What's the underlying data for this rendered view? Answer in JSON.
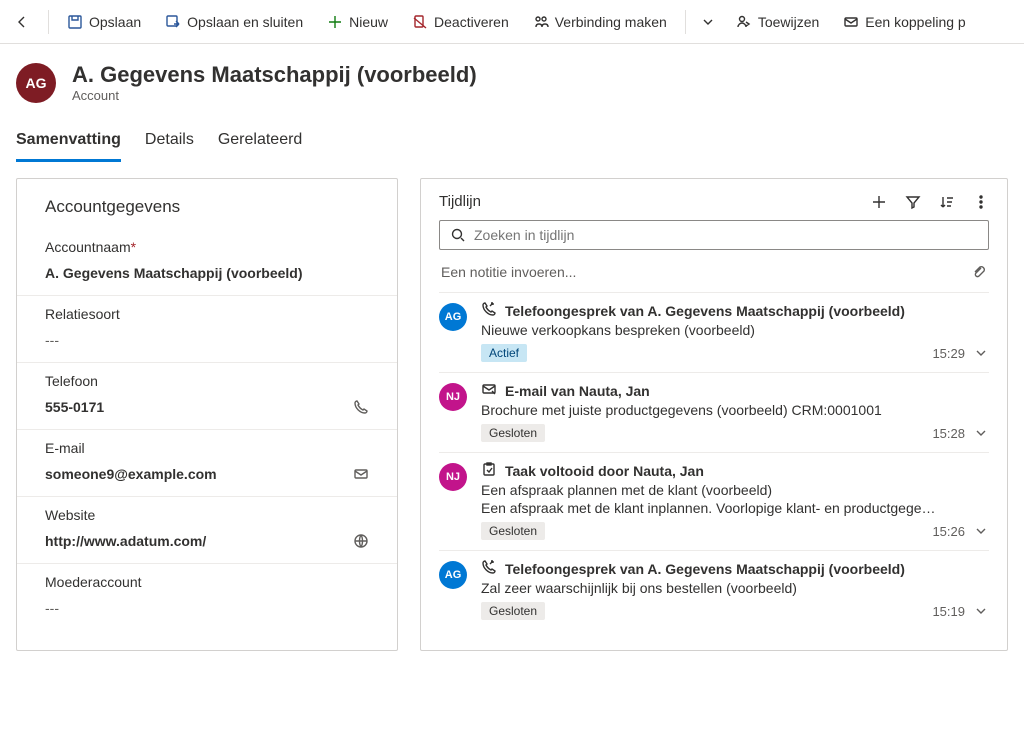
{
  "toolbar": {
    "save": "Opslaan",
    "save_close": "Opslaan en sluiten",
    "new": "Nieuw",
    "deactivate": "Deactiveren",
    "connect": "Verbinding maken",
    "assign": "Toewijzen",
    "link": "Een koppeling p"
  },
  "header": {
    "avatar": "AG",
    "title": "A. Gegevens Maatschappij (voorbeeld)",
    "subtitle": "Account"
  },
  "tabs": {
    "summary": "Samenvatting",
    "details": "Details",
    "related": "Gerelateerd"
  },
  "account": {
    "section": "Accountgegevens",
    "name_label": "Accountnaam",
    "name_value": "A. Gegevens Maatschappij (voorbeeld)",
    "relation_label": "Relatiesoort",
    "relation_value": "---",
    "phone_label": "Telefoon",
    "phone_value": "555-0171",
    "email_label": "E-mail",
    "email_value": "someone9@example.com",
    "website_label": "Website",
    "website_value": "http://www.adatum.com/",
    "parent_label": "Moederaccount",
    "parent_value": "---"
  },
  "timeline": {
    "title": "Tijdlijn",
    "search_placeholder": "Zoeken in tijdlijn",
    "note_placeholder": "Een notitie invoeren...",
    "items": [
      {
        "avatar": "AG",
        "avatar_class": "av-blue",
        "icon": "phone",
        "title": "Telefoongesprek van A. Gegevens Maatschappij (voorbeeld)",
        "desc": "Nieuwe verkoopkans bespreken (voorbeeld)",
        "badge": "Actief",
        "badge_active": true,
        "time": "15:29"
      },
      {
        "avatar": "NJ",
        "avatar_class": "av-magenta",
        "icon": "mail",
        "title": "E-mail van Nauta, Jan",
        "desc": "Brochure met juiste productgegevens (voorbeeld) CRM:0001001",
        "badge": "Gesloten",
        "badge_active": false,
        "time": "15:28"
      },
      {
        "avatar": "NJ",
        "avatar_class": "av-magenta",
        "icon": "task",
        "title": "Taak voltooid door Nauta, Jan",
        "desc": "Een afspraak plannen met de klant (voorbeeld)",
        "desc2": "Een afspraak met de klant inplannen. Voorlopige klant- en productgege…",
        "badge": "Gesloten",
        "badge_active": false,
        "time": "15:26"
      },
      {
        "avatar": "AG",
        "avatar_class": "av-blue",
        "icon": "phone",
        "title": "Telefoongesprek van A. Gegevens Maatschappij (voorbeeld)",
        "desc": "Zal zeer waarschijnlijk bij ons bestellen (voorbeeld)",
        "badge": "Gesloten",
        "badge_active": false,
        "time": "15:19"
      }
    ]
  }
}
